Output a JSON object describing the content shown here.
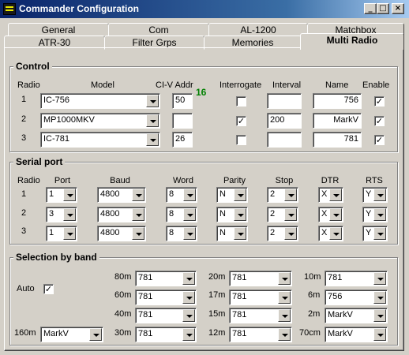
{
  "window": {
    "title": "Commander Configuration",
    "buttons": {
      "minimize": "_",
      "maximize": "□",
      "close": "×"
    }
  },
  "tabs": {
    "row_back": [
      "General",
      "Com",
      "AL-1200",
      "Matchbox"
    ],
    "row_front": [
      "ATR-30",
      "Filter Grps",
      "Memories",
      "Multi Radio"
    ],
    "active": "Multi Radio"
  },
  "control": {
    "title": "Control",
    "headers": {
      "radio": "Radio",
      "model": "Model",
      "civ": "CI-V Addr",
      "interrogate": "Interrogate",
      "interval": "Interval",
      "name": "Name",
      "enable": "Enable"
    },
    "civ_indicator": "16",
    "rows": [
      {
        "radio": "1",
        "model": "IC-756",
        "civ": "50",
        "interrogate": "",
        "interval": "",
        "name": "756",
        "enable": "✓"
      },
      {
        "radio": "2",
        "model": "MP1000MKV",
        "civ": "",
        "interrogate": "✓",
        "interval": "200",
        "name": "MarkV",
        "enable": "✓"
      },
      {
        "radio": "3",
        "model": "IC-781",
        "civ": "26",
        "interrogate": "",
        "interval": "",
        "name": "781",
        "enable": "✓"
      }
    ]
  },
  "serial": {
    "title": "Serial port",
    "headers": {
      "radio": "Radio",
      "port": "Port",
      "baud": "Baud",
      "word": "Word",
      "parity": "Parity",
      "stop": "Stop",
      "dtr": "DTR",
      "rts": "RTS"
    },
    "rows": [
      {
        "radio": "1",
        "port": "1",
        "baud": "4800",
        "word": "8",
        "parity": "N",
        "stop": "2",
        "dtr": "X",
        "rts": "Y"
      },
      {
        "radio": "2",
        "port": "3",
        "baud": "4800",
        "word": "8",
        "parity": "N",
        "stop": "2",
        "dtr": "X",
        "rts": "Y"
      },
      {
        "radio": "3",
        "port": "1",
        "baud": "4800",
        "word": "8",
        "parity": "N",
        "stop": "2",
        "dtr": "X",
        "rts": "Y"
      }
    ]
  },
  "band": {
    "title": "Selection by band",
    "auto_label": "Auto",
    "auto_checked": "✓",
    "bands": [
      {
        "label": "80m",
        "value": "781"
      },
      {
        "label": "60m",
        "value": "781"
      },
      {
        "label": "40m",
        "value": "781"
      },
      {
        "label": "30m",
        "value": "781"
      },
      {
        "label": "20m",
        "value": "781"
      },
      {
        "label": "17m",
        "value": "781"
      },
      {
        "label": "15m",
        "value": "781"
      },
      {
        "label": "12m",
        "value": "781"
      },
      {
        "label": "10m",
        "value": "781"
      },
      {
        "label": "6m",
        "value": "756"
      },
      {
        "label": "2m",
        "value": "MarkV"
      },
      {
        "label": "70cm",
        "value": "MarkV"
      },
      {
        "label": "160m",
        "value": "MarkV"
      }
    ]
  }
}
